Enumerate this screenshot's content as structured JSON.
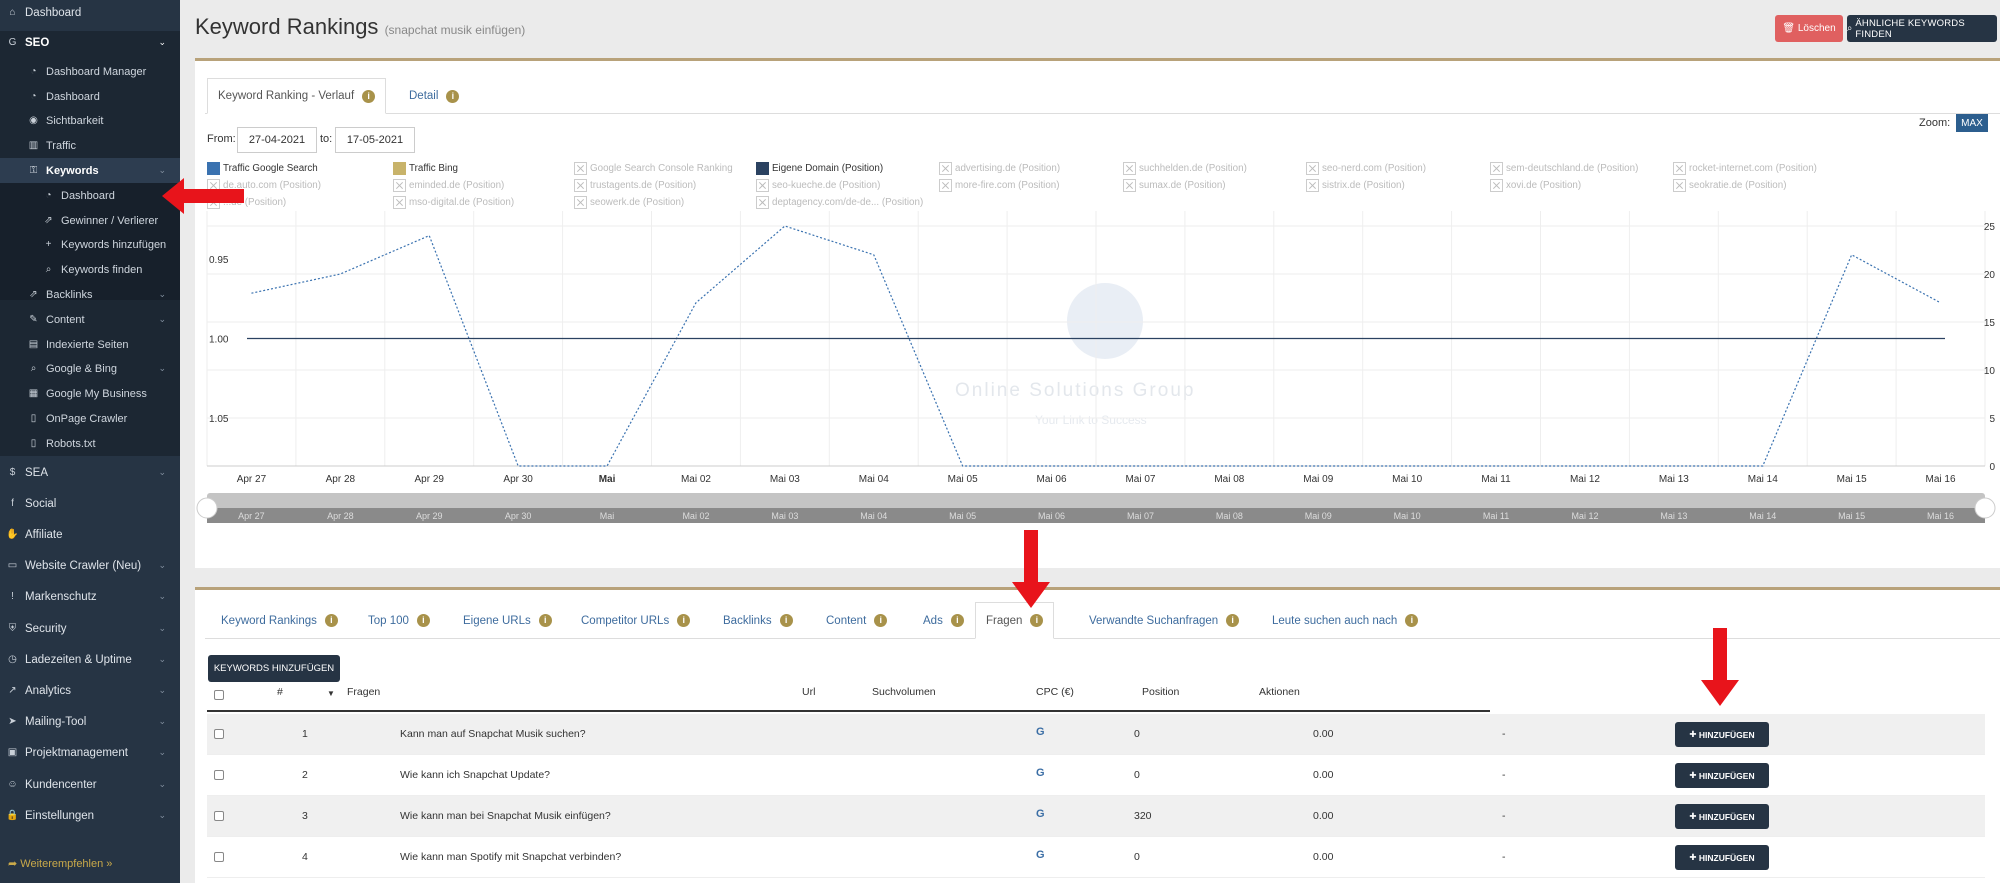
{
  "sidebar": {
    "items": [
      {
        "label": "Dashboard",
        "icon": "home-icon"
      },
      {
        "label": "SEO",
        "icon": "google-icon"
      },
      {
        "label": "Dashboard Manager",
        "icon": "dashboard-icon"
      },
      {
        "label": "Dashboard",
        "icon": "dashboard-icon"
      },
      {
        "label": "Sichtbarkeit",
        "icon": "eye-icon"
      },
      {
        "label": "Traffic",
        "icon": "chart-icon"
      },
      {
        "label": "Keywords",
        "icon": "key-icon"
      },
      {
        "label": "Dashboard",
        "icon": "dashboard-icon"
      },
      {
        "label": "Gewinner / Verlierer",
        "icon": "external-link-icon"
      },
      {
        "label": "Keywords hinzufügen",
        "icon": "plus-icon"
      },
      {
        "label": "Keywords finden",
        "icon": "search-icon"
      },
      {
        "label": "Backlinks",
        "icon": "external-link-icon"
      },
      {
        "label": "Content",
        "icon": "edit-icon"
      },
      {
        "label": "Indexierte Seiten",
        "icon": "document-icon"
      },
      {
        "label": "Google & Bing",
        "icon": "search-icon"
      },
      {
        "label": "Google My Business",
        "icon": "building-icon"
      },
      {
        "label": "OnPage Crawler",
        "icon": "file-icon"
      },
      {
        "label": "Robots.txt",
        "icon": "file-icon"
      },
      {
        "label": "SEA",
        "icon": "dollar-icon"
      },
      {
        "label": "Social",
        "icon": "facebook-icon"
      },
      {
        "label": "Affiliate",
        "icon": "handshake-icon"
      },
      {
        "label": "Website Crawler (Neu)",
        "icon": "laptop-icon"
      },
      {
        "label": "Markenschutz",
        "icon": "exclamation-icon"
      },
      {
        "label": "Security",
        "icon": "shield-icon"
      },
      {
        "label": "Ladezeiten & Uptime",
        "icon": "clock-icon"
      },
      {
        "label": "Analytics",
        "icon": "line-chart-icon"
      },
      {
        "label": "Mailing-Tool",
        "icon": "send-icon"
      },
      {
        "label": "Projektmanagement",
        "icon": "briefcase-icon"
      },
      {
        "label": "Kundencenter",
        "icon": "users-icon"
      },
      {
        "label": "Einstellungen",
        "icon": "lock-icon"
      }
    ],
    "recommend": "Weiterempfehlen »"
  },
  "header": {
    "title": "Keyword Rankings",
    "subtitle": "(snapchat musik einfügen)",
    "delete_label": "Löschen",
    "similar_label": "ÄHNLICHE KEYWORDS FINDEN"
  },
  "chart_panel": {
    "tabs": [
      "Keyword Ranking - Verlauf",
      "Detail"
    ],
    "from_label": "From:",
    "from_value": "27-04-2021",
    "to_label": "to:",
    "to_value": "17-05-2021",
    "zoom_label": "Zoom:",
    "zoom_value": "MAX",
    "watermark_title": "Online Solutions Group",
    "watermark_tag": "Your Link to Success"
  },
  "chart_data": {
    "type": "line",
    "x": [
      "Apr 27",
      "Apr 28",
      "Apr 29",
      "Apr 30",
      "Mai",
      "Mai 02",
      "Mai 03",
      "Mai 04",
      "Mai 05",
      "Mai 06",
      "Mai 07",
      "Mai 08",
      "Mai 09",
      "Mai 10",
      "Mai 11",
      "Mai 12",
      "Mai 13",
      "Mai 14",
      "Mai 15",
      "Mai 16"
    ],
    "left_ticks": [
      "0.95",
      "1.00",
      "1.05"
    ],
    "right_ticks": [
      "25",
      "20",
      "15",
      "10",
      "5",
      "0"
    ],
    "left_ylim": [
      0.92,
      1.08
    ],
    "right_ylim": [
      0,
      25
    ],
    "series": [
      {
        "name": "Traffic Google Search",
        "color": "#3a72b0",
        "values": [
          18,
          20,
          24,
          0,
          0,
          17,
          25,
          22,
          0,
          0,
          0,
          0,
          0,
          0,
          0,
          0,
          0,
          0,
          22,
          17
        ],
        "style": "dotted"
      },
      {
        "name": "Eigene Domain (Position)",
        "color": "#2b4261",
        "axis": "left",
        "values": [
          1,
          1,
          1,
          1,
          1,
          1,
          1,
          1,
          1,
          1,
          1,
          1,
          1,
          1,
          1,
          1,
          1,
          1,
          1,
          1
        ],
        "style": "solid"
      }
    ],
    "grid": true
  },
  "legend": [
    {
      "label": "Traffic Google Search",
      "color": "#3a72b0",
      "on": true
    },
    {
      "label": "Traffic Bing",
      "color": "#c8b36a",
      "on": true
    },
    {
      "label": "Google Search Console Ranking",
      "on": false
    },
    {
      "label": "Eigene Domain (Position)",
      "color": "#2b4261",
      "on": true
    },
    {
      "label": "advertising.de (Position)",
      "on": false
    },
    {
      "label": "suchhelden.de (Position)",
      "on": false
    },
    {
      "label": "seo-nerd.com (Position)",
      "on": false
    },
    {
      "label": "sem-deutschland.de (Position)",
      "on": false
    },
    {
      "label": "rocket-internet.com (Position)",
      "on": false
    },
    {
      "label": "de.auto.com (Position)",
      "on": false
    },
    {
      "label": "eminded.de (Position)",
      "on": false
    },
    {
      "label": "trustagents.de (Position)",
      "on": false
    },
    {
      "label": "seo-kueche.de (Position)",
      "on": false
    },
    {
      "label": "more-fire.com (Position)",
      "on": false
    },
    {
      "label": "sumax.de (Position)",
      "on": false
    },
    {
      "label": "sistrix.de (Position)",
      "on": false
    },
    {
      "label": "xovi.de (Position)",
      "on": false
    },
    {
      "label": "seokratie.de (Position)",
      "on": false
    },
    {
      "label": "...de (Position)",
      "on": false
    },
    {
      "label": "mso-digital.de (Position)",
      "on": false
    },
    {
      "label": "seowerk.de (Position)",
      "on": false
    },
    {
      "label": "deptagency.com/de-de... (Position)",
      "on": false
    }
  ],
  "table_panel": {
    "tabs": [
      "Keyword Rankings",
      "Top 100",
      "Eigene URLs",
      "Competitor URLs",
      "Backlinks",
      "Content",
      "Ads",
      "Fragen",
      "Verwandte Suchanfragen",
      "Leute suchen auch nach"
    ],
    "active_tab": "Fragen",
    "add_keywords_label": "KEYWORDS HINZUFÜGEN",
    "headers": [
      "#",
      "Fragen",
      "Url",
      "Suchvolumen",
      "CPC (€)",
      "Position",
      "Aktionen"
    ],
    "rows": [
      {
        "num": "1",
        "question": "Kann man auf Snapchat Musik suchen?",
        "volume": "0",
        "cpc": "0.00",
        "position": "-",
        "action": "HINZUFÜGEN"
      },
      {
        "num": "2",
        "question": "Wie kann ich Snapchat Update?",
        "volume": "0",
        "cpc": "0.00",
        "position": "-",
        "action": "HINZUFÜGEN"
      },
      {
        "num": "3",
        "question": "Wie kann man bei Snapchat Musik einfügen?",
        "volume": "320",
        "cpc": "0.00",
        "position": "-",
        "action": "HINZUFÜGEN"
      },
      {
        "num": "4",
        "question": "Wie kann man Spotify mit Snapchat verbinden?",
        "volume": "0",
        "cpc": "0.00",
        "position": "-",
        "action": "HINZUFÜGEN"
      }
    ]
  },
  "colors": {
    "sidebar": "#263444",
    "accent_gold": "#b8a27a",
    "button_dark": "#263444",
    "danger": "#e06060",
    "arrow": "#e8141b"
  }
}
